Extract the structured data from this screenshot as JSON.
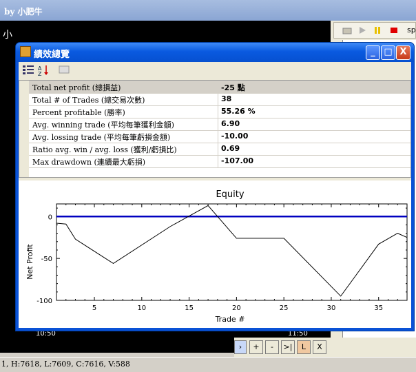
{
  "app": {
    "title": "by 小肥牛",
    "status": "1, H:7618, L:7609, C:7616, V:588",
    "time_labels": [
      "10:50",
      "11:50"
    ],
    "bottom_buttons": [
      "+",
      "-",
      ">|",
      "L",
      "X"
    ],
    "right_text": "sp",
    "left_fragment": "小"
  },
  "dialog": {
    "title": "績效總覽",
    "window_buttons": {
      "minimize": "_",
      "maximize": "□",
      "close": "X"
    },
    "rows": [
      {
        "label": "Total net profit (總損益)",
        "value": "-25 點"
      },
      {
        "label": "Total # of Trades (總交易次數)",
        "value": "38"
      },
      {
        "label": "Percent profitable (勝率)",
        "value": "55.26 %"
      },
      {
        "label": "Avg. winning trade (平均每筆獲利金額)",
        "value": "6.90"
      },
      {
        "label": "Avg. lossing trade (平均每筆虧損金額)",
        "value": "-10.00"
      },
      {
        "label": "Ratio avg. win / avg. loss (獲利/虧損比)",
        "value": "0.69"
      },
      {
        "label": "Max drawdown (連續最大虧損)",
        "value": "-107.00"
      }
    ]
  },
  "chart_data": {
    "type": "line",
    "title": "Equity",
    "xlabel": "Trade #",
    "ylabel": "Net Profit",
    "xlim": [
      1,
      38
    ],
    "ylim": [
      -100,
      15
    ],
    "xticks": [
      5,
      10,
      15,
      20,
      25,
      30,
      35
    ],
    "yticks": [
      0,
      -50,
      -100
    ],
    "zero_line_color": "#0000c0",
    "series": [
      {
        "x": [
          1,
          2,
          3,
          7,
          13,
          17,
          20,
          25,
          31,
          35,
          37,
          38
        ],
        "y": [
          -8,
          -9,
          -27,
          -56,
          -12,
          13,
          -26,
          -26,
          -95,
          -33,
          -20,
          -25
        ]
      }
    ]
  }
}
